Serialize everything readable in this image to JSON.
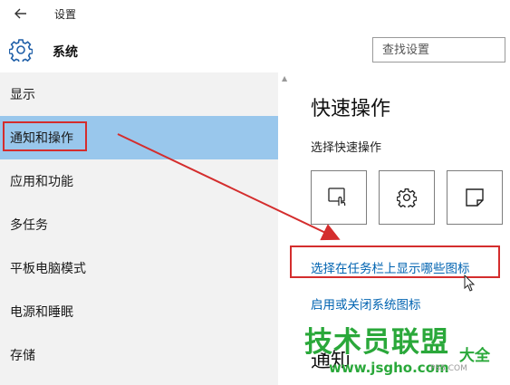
{
  "window": {
    "title": "设置"
  },
  "header": {
    "section_title": "系统",
    "search": {
      "placeholder": "查找设置",
      "value": ""
    }
  },
  "sidebar": {
    "items": [
      {
        "label": "显示",
        "selected": false
      },
      {
        "label": "通知和操作",
        "selected": true
      },
      {
        "label": "应用和功能",
        "selected": false
      },
      {
        "label": "多任务",
        "selected": false
      },
      {
        "label": "平板电脑模式",
        "selected": false
      },
      {
        "label": "电源和睡眠",
        "selected": false
      },
      {
        "label": "存储",
        "selected": false
      }
    ]
  },
  "content": {
    "title": "快速操作",
    "subtitle": "选择快速操作",
    "tiles": [
      {
        "icon": "tablet-mode-icon"
      },
      {
        "icon": "settings-gear-icon"
      },
      {
        "icon": "note-icon"
      }
    ],
    "links": {
      "taskbar_icons": "选择在任务栏上显示哪些图标",
      "system_icons": "启用或关闭系统图标"
    },
    "next_heading": "通知"
  },
  "watermark": {
    "main": "技术员联盟",
    "url": "www.jsgho.com",
    "side": "大全",
    "mark": "P85.COM"
  },
  "colors": {
    "accent_selected": "#99c7ec",
    "link": "#0063b1",
    "annotation_red": "#d42d2d",
    "watermark_green": "#2aa83a",
    "sidebar_bg": "#f2f2f2"
  }
}
